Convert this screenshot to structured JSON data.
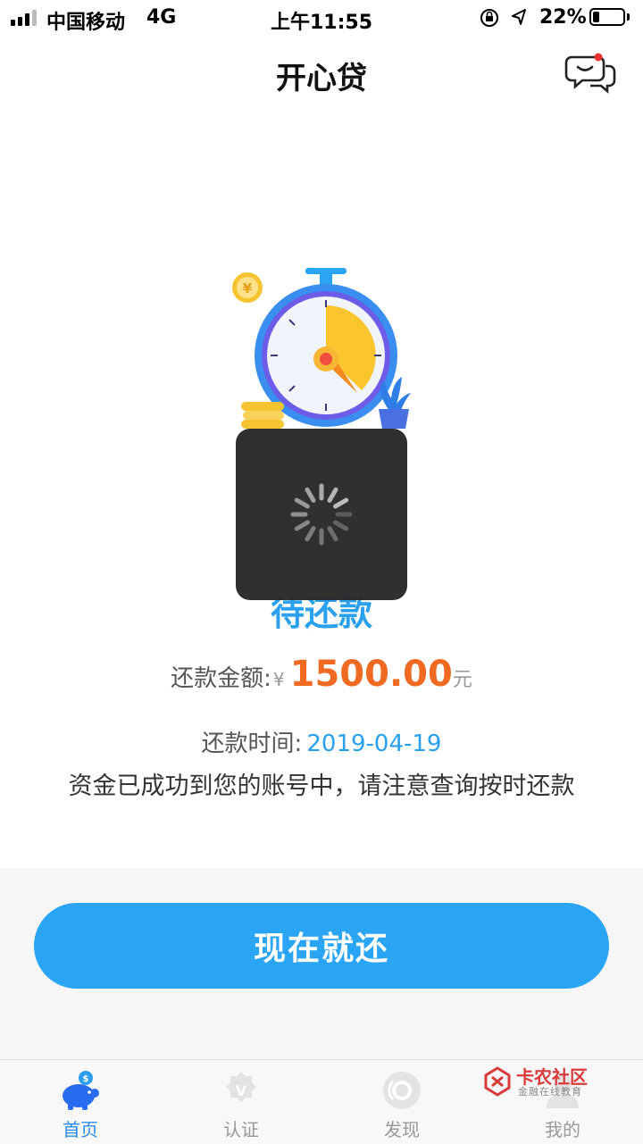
{
  "status_bar": {
    "carrier": "中国移动",
    "network": "4G",
    "time": "上午11:55",
    "battery_percent": "22%",
    "battery_level": 0.22
  },
  "nav": {
    "title": "开心贷",
    "message_icon": "chat-bubble-icon",
    "has_notification_dot": true
  },
  "hero_icon": "stopwatch-coins-illustration",
  "loan": {
    "status": "待还款",
    "amount_label": "还款金额:",
    "currency_symbol": "¥",
    "amount": "1500.00",
    "amount_unit": "元",
    "date_label": "还款时间:",
    "date": "2019-04-19",
    "notice": "资金已成功到您的账号中，请注意查询按时还款"
  },
  "actions": {
    "repay_label": "现在就还"
  },
  "tabs": [
    {
      "label": "首页",
      "icon": "piggy-bank-icon",
      "active": true
    },
    {
      "label": "认证",
      "icon": "verified-badge-icon",
      "active": false
    },
    {
      "label": "发现",
      "icon": "discover-icon",
      "active": false
    },
    {
      "label": "我的",
      "icon": "profile-icon",
      "active": false
    }
  ],
  "watermark": {
    "title": "卡农社区",
    "subtitle": "金融在线教育"
  },
  "colors": {
    "accent": "#2aa4f4",
    "amount": "#f06a22",
    "status_text": "#2aa0ef",
    "tab_active": "#2a8be8"
  },
  "loading_visible": true
}
